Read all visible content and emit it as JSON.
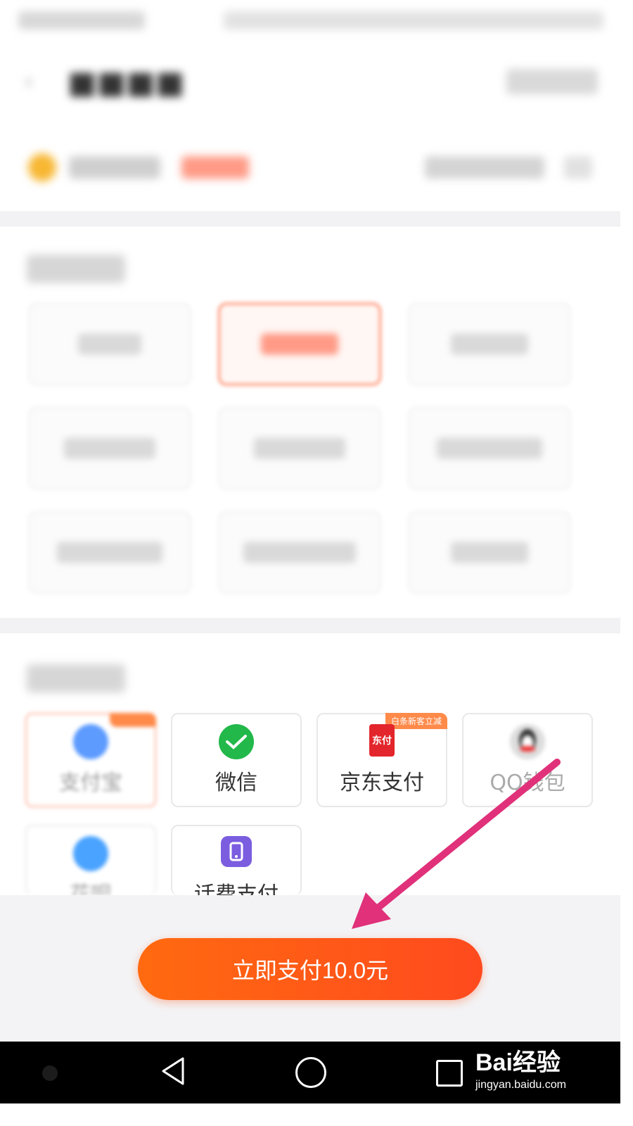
{
  "payment_methods": [
    {
      "name": "alipay",
      "label": "支付宝",
      "icon": "alipay-icon",
      "selected": true
    },
    {
      "name": "wechat",
      "label": "微信",
      "icon": "wechat-icon"
    },
    {
      "name": "jd",
      "label": "京东支付",
      "icon": "jd-pay-icon",
      "icon_text": "东付",
      "badge": "白条新客立减"
    },
    {
      "name": "qq",
      "label": "QQ钱包",
      "icon": "qq-penguin-icon"
    },
    {
      "name": "huabei",
      "label": "花呗",
      "icon": "huabei-icon"
    },
    {
      "name": "phone",
      "label": "话费支付",
      "icon": "phone-bill-icon"
    }
  ],
  "pay_button": {
    "label": "立即支付10.0元",
    "color": "#ff5a1e"
  },
  "watermark": {
    "logo": "Bai经验",
    "url": "jingyan.baidu.com"
  },
  "colors": {
    "accent": "#ff5a1e",
    "annotation_arrow": "#e0317a"
  }
}
